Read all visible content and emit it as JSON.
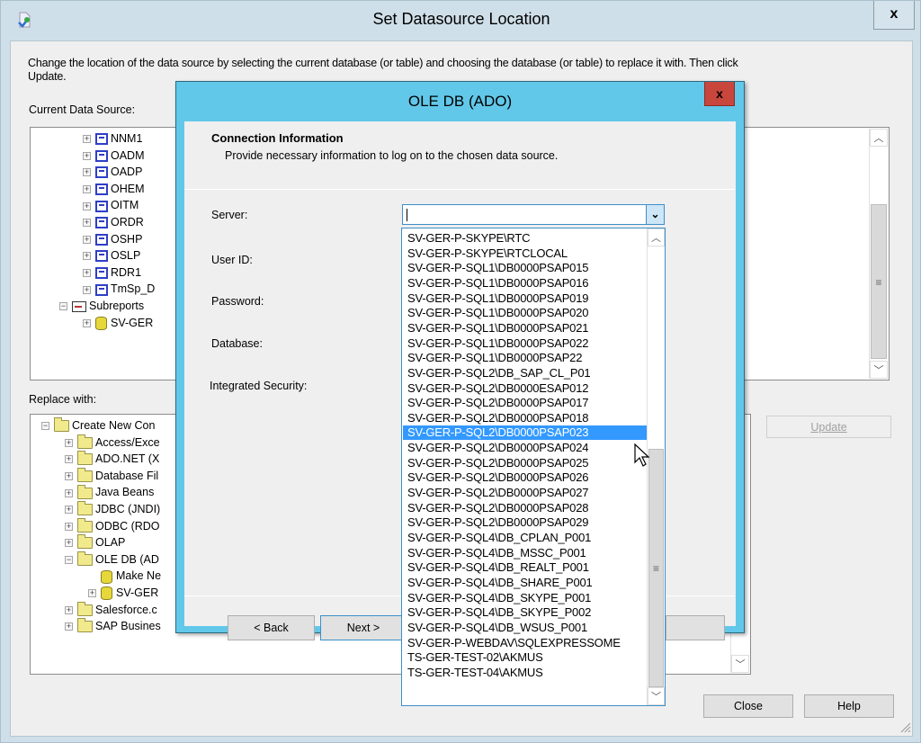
{
  "outer_window": {
    "title": "Set Datasource Location",
    "close_label": "x",
    "description": "Change the location of the data source by selecting the current database (or table) and choosing the database (or table) to replace it with.  Then click Update.",
    "current_label": "Current Data Source:",
    "replace_label": "Replace with:",
    "current_tree": [
      {
        "label": "NNM1",
        "icon": "table-icon",
        "expander": "+"
      },
      {
        "label": "OADM",
        "icon": "table-icon",
        "expander": "+"
      },
      {
        "label": "OADP",
        "icon": "table-icon",
        "expander": "+"
      },
      {
        "label": "OHEM",
        "icon": "table-icon",
        "expander": "+"
      },
      {
        "label": "OITM",
        "icon": "table-icon",
        "expander": "+"
      },
      {
        "label": "ORDR",
        "icon": "table-icon",
        "expander": "+"
      },
      {
        "label": "OSHP",
        "icon": "table-icon",
        "expander": "+"
      },
      {
        "label": "OSLP",
        "icon": "table-icon",
        "expander": "+"
      },
      {
        "label": "RDR1",
        "icon": "table-icon",
        "expander": "+"
      },
      {
        "label": "TmSp_D",
        "icon": "table-icon",
        "expander": "+"
      },
      {
        "label": "Subreports",
        "icon": "subreport-icon",
        "expander": "−"
      },
      {
        "label": "SV-GER",
        "icon": "database-link-icon",
        "expander": "+"
      }
    ],
    "replace_tree": [
      {
        "label": "Create New Con",
        "icon": "folder-icon",
        "expander": "−"
      },
      {
        "label": "Access/Exce",
        "icon": "folder-icon",
        "expander": "+"
      },
      {
        "label": "ADO.NET (X",
        "icon": "folder-icon",
        "expander": "+"
      },
      {
        "label": "Database Fil",
        "icon": "folder-icon",
        "expander": "+"
      },
      {
        "label": "Java Beans",
        "icon": "folder-icon",
        "expander": "+"
      },
      {
        "label": "JDBC (JNDI)",
        "icon": "folder-icon",
        "expander": "+"
      },
      {
        "label": "ODBC (RDO",
        "icon": "folder-icon",
        "expander": "+"
      },
      {
        "label": "OLAP",
        "icon": "folder-icon",
        "expander": "+"
      },
      {
        "label": "OLE DB (AD",
        "icon": "folder-icon",
        "expander": "−"
      },
      {
        "label": "Make Ne",
        "icon": "new-connection-icon",
        "expander": ""
      },
      {
        "label": "SV-GER",
        "icon": "database-icon",
        "expander": "+"
      },
      {
        "label": "Salesforce.c",
        "icon": "folder-icon",
        "expander": "+"
      },
      {
        "label": "SAP Busines",
        "icon": "folder-icon",
        "expander": "+"
      }
    ],
    "buttons": {
      "update": "Update",
      "close": "Close",
      "help": "Help"
    }
  },
  "inner_dialog": {
    "title": "OLE DB (ADO)",
    "close_label": "x",
    "section_title": "Connection Information",
    "section_subtitle": "Provide necessary information to log on to the chosen data source.",
    "fields": {
      "server_label": "Server:",
      "server_value": "",
      "user_id_label": "User ID:",
      "password_label": "Password:",
      "database_label": "Database:",
      "integrated_security_label": "Integrated Security:"
    },
    "buttons": {
      "back": "< Back",
      "next": "Next >"
    },
    "server_options": [
      "SV-GER-P-SKYPE\\RTC",
      "SV-GER-P-SKYPE\\RTCLOCAL",
      "SV-GER-P-SQL1\\DB0000PSAP015",
      "SV-GER-P-SQL1\\DB0000PSAP016",
      "SV-GER-P-SQL1\\DB0000PSAP019",
      "SV-GER-P-SQL1\\DB0000PSAP020",
      "SV-GER-P-SQL1\\DB0000PSAP021",
      "SV-GER-P-SQL1\\DB0000PSAP022",
      "SV-GER-P-SQL1\\DB0000PSAP22",
      "SV-GER-P-SQL2\\DB_SAP_CL_P01",
      "SV-GER-P-SQL2\\DB0000ESAP012",
      "SV-GER-P-SQL2\\DB0000PSAP017",
      "SV-GER-P-SQL2\\DB0000PSAP018",
      "SV-GER-P-SQL2\\DB0000PSAP023",
      "SV-GER-P-SQL2\\DB0000PSAP024",
      "SV-GER-P-SQL2\\DB0000PSAP025",
      "SV-GER-P-SQL2\\DB0000PSAP026",
      "SV-GER-P-SQL2\\DB0000PSAP027",
      "SV-GER-P-SQL2\\DB0000PSAP028",
      "SV-GER-P-SQL2\\DB0000PSAP029",
      "SV-GER-P-SQL4\\DB_CPLAN_P001",
      "SV-GER-P-SQL4\\DB_MSSC_P001",
      "SV-GER-P-SQL4\\DB_REALT_P001",
      "SV-GER-P-SQL4\\DB_SHARE_P001",
      "SV-GER-P-SQL4\\DB_SKYPE_P001",
      "SV-GER-P-SQL4\\DB_SKYPE_P002",
      "SV-GER-P-SQL4\\DB_WSUS_P001",
      "SV-GER-P-WEBDAV\\SQLEXPRESSOME",
      "TS-GER-TEST-02\\AKMUS",
      "TS-GER-TEST-04\\AKMUS"
    ],
    "highlighted_option_index": 13
  },
  "colors": {
    "accent_frame": "#62c8e9",
    "close_red": "#c9463d",
    "selection": "#3399ff"
  }
}
